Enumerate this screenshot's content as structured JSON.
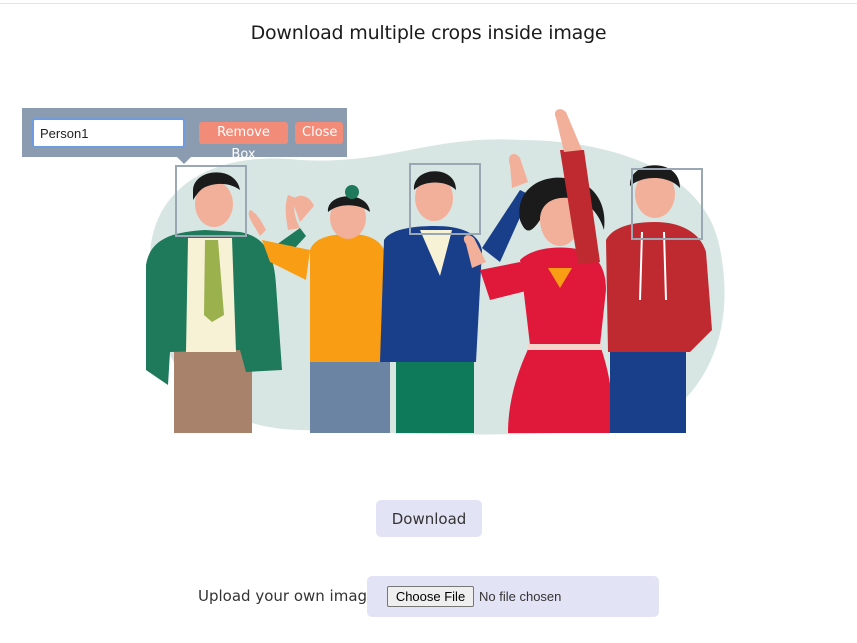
{
  "page": {
    "title": "Download multiple crops inside image"
  },
  "popup": {
    "name_value": "Person1",
    "remove_box_label": "Remove Box",
    "close_label": "Close"
  },
  "actions": {
    "download_label": "Download"
  },
  "upload": {
    "label": "Upload your own image",
    "choose_file_label": "Choose File",
    "no_file_text": "No file chosen"
  },
  "colors": {
    "popup_bg": "#8b9bb0",
    "popup_button": "#f28b78",
    "action_bg": "#e3e3f6",
    "crop_box_border": "#9aa7b5"
  },
  "illustration": {
    "subject": "group of five people waving",
    "crop_box_count": 3
  }
}
